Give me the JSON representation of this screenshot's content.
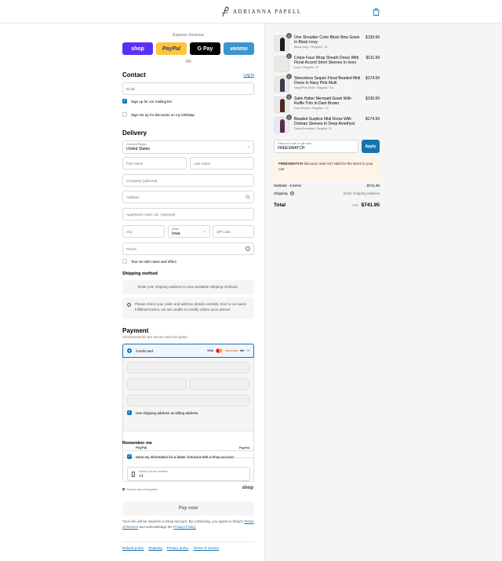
{
  "brand": {
    "name": "ADRIANNA PAPELL"
  },
  "express": {
    "title": "Express checkout",
    "wallets": [
      {
        "label": "shop"
      },
      {
        "label": "PayPal"
      },
      {
        "label": "G Pay"
      },
      {
        "label": "venmo"
      }
    ],
    "or": "OR"
  },
  "contact": {
    "title": "Contact",
    "login": "Log in",
    "email_placeholder": "Email",
    "mailing_list": "Sign up for our mailing list",
    "birthday": "Sign me up for discounts on my birthday!"
  },
  "delivery": {
    "title": "Delivery",
    "country_label": "Country/Region",
    "country_value": "United States",
    "first_name": "First name",
    "last_name": "Last name",
    "company": "Company (optional)",
    "address": "Address",
    "apartment": "Apartment, suite, etc. (optional)",
    "city": "City",
    "state_label": "State",
    "state_value": "Iowa",
    "zip": "ZIP code",
    "phone": "Phone",
    "text_news": "Text me with news and offers"
  },
  "shipping": {
    "title": "Shipping method",
    "placeholder_notice": "Enter your shipping address to view available shipping methods.",
    "info_notice": "Please check your order and address details carefully. Due to our quick fulfillment times, we are unable to modify orders once placed."
  },
  "payment": {
    "title": "Payment",
    "subtitle": "All transactions are secure and encrypted.",
    "credit_card": "Credit card",
    "card_brands": [
      "VISA",
      "mc",
      "DISCOVER",
      "elo",
      "+3"
    ],
    "use_shipping_as_billing": "Use shipping address as billing address",
    "paypal": "PayPal",
    "paypal_logo": "PayPal"
  },
  "remember": {
    "title": "Remember me",
    "save_info": "Save my information for a faster checkout with a Shop account",
    "phone_label": "Mobile phone number",
    "phone_value": "+1",
    "secure": "Secure and encrypted",
    "shop_logo": "shop"
  },
  "pay_now": "Pay now",
  "legal": {
    "text": "Your info will be saved to a Shop account. By continuing, you agree to Shop's",
    "terms": "Terms of Service",
    "and": "and acknowledge the",
    "privacy": "Privacy Policy."
  },
  "footer_links": [
    "Refund policy",
    "Shipping",
    "Privacy policy",
    "Terms of service"
  ],
  "order": {
    "items": [
      {
        "qty": "1",
        "name": "One Shoulder Color Block Bow Gown In Black Ivory",
        "variant": "Black Ivory / Regular / 16",
        "price": "$139.99",
        "color": "#1a1a1a"
      },
      {
        "qty": "1",
        "name": "Crepe Faux Wrap Sheath Dress With Floral Accent Short Sleeves In Ivory",
        "variant": "Ivory / Regular / 8",
        "price": "$111.99",
        "color": "#efe9dc"
      },
      {
        "qty": "1",
        "name": "Sleeveless Sequin Floral Beaded Midi Dress In Navy Pink Multi",
        "variant": "Navy/Pink Multi / Regular / 16",
        "price": "$174.99",
        "color": "#3b3b52"
      },
      {
        "qty": "1",
        "name": "Satin Halter Mermaid Gown With Ruffle Trim In Dark Brown",
        "variant": "Dark Brown / Regular / 14",
        "price": "$139.99",
        "color": "#4a2c1c"
      },
      {
        "qty": "1",
        "name": "Beaded Surplice Midi Dress With Dolman Sleeves In Deep Amethyst",
        "variant": "Deep Amethyst / Regular / 8",
        "price": "$174.99",
        "color": "#5b2a52"
      }
    ],
    "discount_label": "Discount code or gift card",
    "discount_value": "FREESWATCH",
    "apply": "Apply",
    "warning_code": "FREESWATCH",
    "warning_text": "discount code isn't valid for the items in your cart",
    "subtotal_label": "Subtotal · 5 items",
    "subtotal_value": "$741.95",
    "shipping_label": "Shipping",
    "shipping_value": "Enter shipping address",
    "total_label": "Total",
    "currency": "USD",
    "total_value": "$741.95"
  },
  "colors": {
    "accent": "#1773b0",
    "shop": "#5a31f4",
    "paypal": "#ffc439",
    "venmo": "#3d95ce",
    "warning_bg": "#fff4e5"
  }
}
